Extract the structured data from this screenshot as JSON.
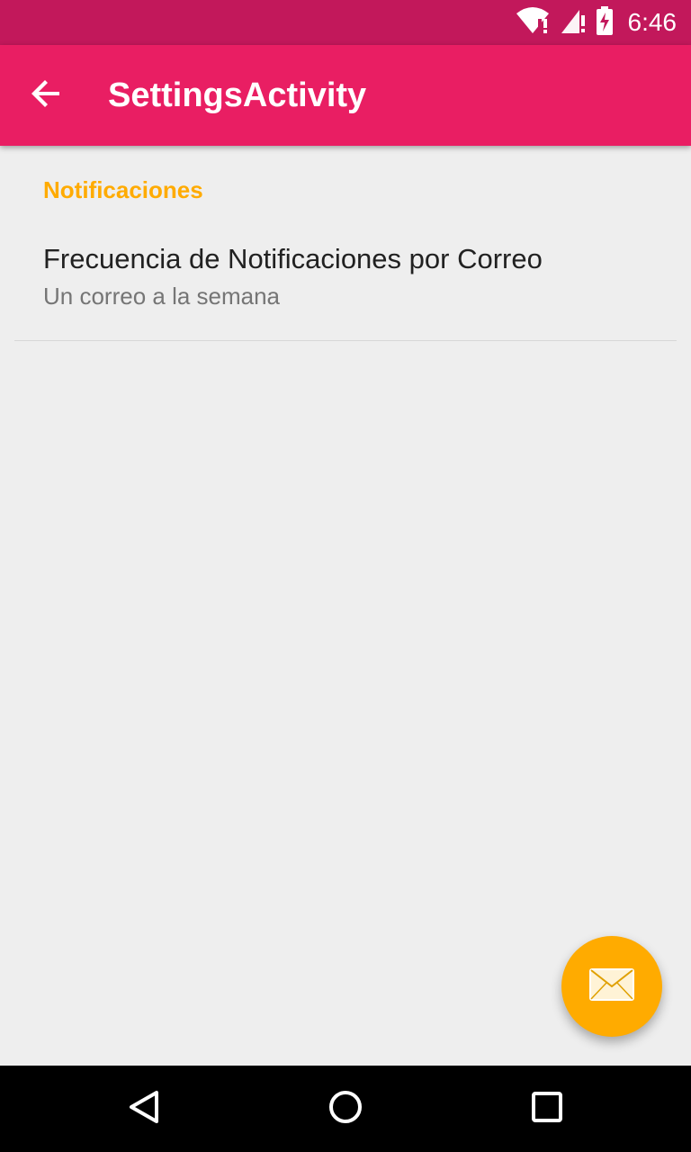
{
  "status_bar": {
    "time": "6:46",
    "icons": [
      "wifi-alert-icon",
      "signal-alert-icon",
      "battery-charging-icon"
    ],
    "color": "#c2185b"
  },
  "app_bar": {
    "title": "SettingsActivity",
    "back_icon": "arrow-back-icon",
    "color": "#e91e63"
  },
  "preferences": {
    "category_title": "Notificaciones",
    "category_color": "#ffab00",
    "items": [
      {
        "title": "Frecuencia de Notificaciones por Correo",
        "summary": "Un correo a la semana"
      }
    ]
  },
  "fab": {
    "icon": "mail-icon",
    "color": "#ffab00"
  },
  "nav_bar": {
    "buttons": [
      "back-triangle-icon",
      "home-circle-icon",
      "recents-square-icon"
    ]
  }
}
